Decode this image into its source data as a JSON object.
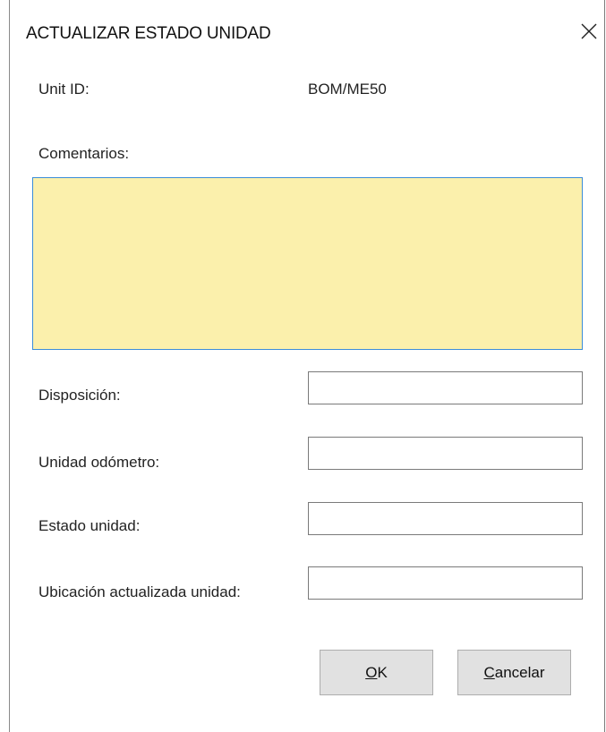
{
  "dialog": {
    "title": "ACTUALIZAR ESTADO UNIDAD",
    "close_icon": "close-icon"
  },
  "unit": {
    "label": "Unit ID:",
    "value": "BOM/ME50"
  },
  "comments": {
    "label": "Comentarios:",
    "value": "",
    "background_color": "#fbf0ac"
  },
  "fields": {
    "disposicion_label": "Disposición:",
    "disposicion_value": "",
    "odometro_label": "Unidad odómetro:",
    "odometro_value": "",
    "estado_label": "Estado unidad:",
    "estado_value": "",
    "ubicacion_label": "Ubicación actualizada unidad:",
    "ubicacion_value": ""
  },
  "buttons": {
    "ok_mnemonic": "O",
    "ok_rest": "K",
    "cancel_mnemonic": "C",
    "cancel_rest": "ancelar"
  }
}
